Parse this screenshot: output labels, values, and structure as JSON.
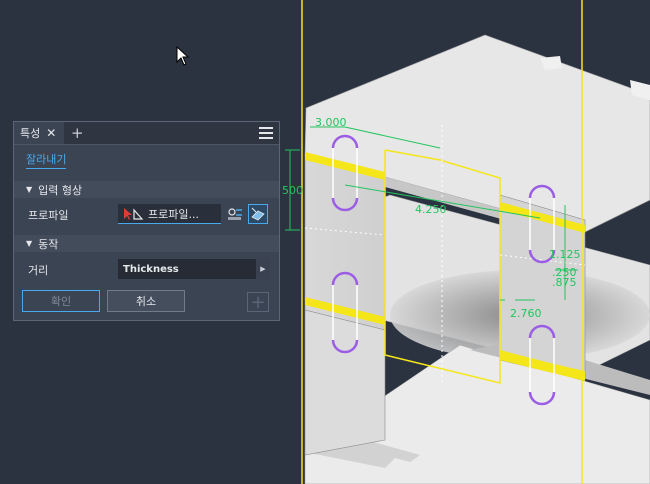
{
  "panel": {
    "tab_label": "특성",
    "tab_close": "✕",
    "tab_add": "+",
    "feature_name": "잘라내기",
    "section_input": "입력 형상",
    "section_behavior": "동작",
    "profile_label": "프로파일",
    "profile_value": "프로파일...",
    "distance_label": "거리",
    "distance_value": "Thickness",
    "ok_label": "확인",
    "cancel_label": "취소",
    "plus_label": "+"
  },
  "dimensions": {
    "d1": "3.000",
    "d2": "500",
    "d3": "4.250",
    "d4": "1.125",
    "d5": ".250",
    ".d6": ".875",
    "d7": "2.760"
  },
  "colors": {
    "background": "#2c3340",
    "sketch_line": "#f5e61a",
    "dimension": "#22c55e",
    "slot": "#9b5de5",
    "accent": "#4aa9ea"
  },
  "icons": [
    "cursor-arrow-icon",
    "close-icon",
    "plus-icon",
    "menu-icon",
    "profile-select-icon",
    "flip-direction-icon",
    "solid-select-icon"
  ]
}
